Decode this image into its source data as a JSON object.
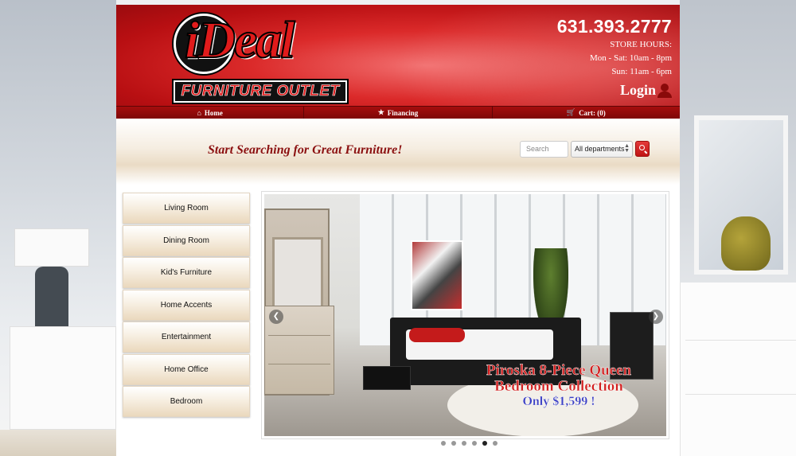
{
  "header": {
    "logo_word": "iDeal",
    "logo_tagline": "FURNITURE OUTLET",
    "phone": "631.393.2777",
    "hours_title": "STORE HOURS:",
    "hours": [
      "Mon - Sat: 10am - 8pm",
      "Sun: 11am - 6pm"
    ],
    "login_label": "Login"
  },
  "nav": [
    {
      "label": "Home",
      "icon": "home-icon"
    },
    {
      "label": "Financing",
      "icon": "star-icon"
    },
    {
      "label": "Cart: (0)",
      "icon": "cart-icon"
    }
  ],
  "search": {
    "tagline": "Start Searching for Great Furniture!",
    "placeholder": "Search",
    "department": "All departments"
  },
  "categories": [
    "Living Room",
    "Dining Room",
    "Kid's Furniture",
    "Home Accents",
    "Entertainment",
    "Home Office",
    "Bedroom"
  ],
  "slider": {
    "caption_title_line1": "Piroska 8-Piece Queen",
    "caption_title_line2": "Bedroom Collection",
    "caption_price": "Only $1,599 !",
    "slide_count": 6,
    "active_slide": 5
  },
  "colors": {
    "brand_red": "#c01414",
    "tagline_red": "#8b1010",
    "price_blue": "#3a3ec4"
  }
}
